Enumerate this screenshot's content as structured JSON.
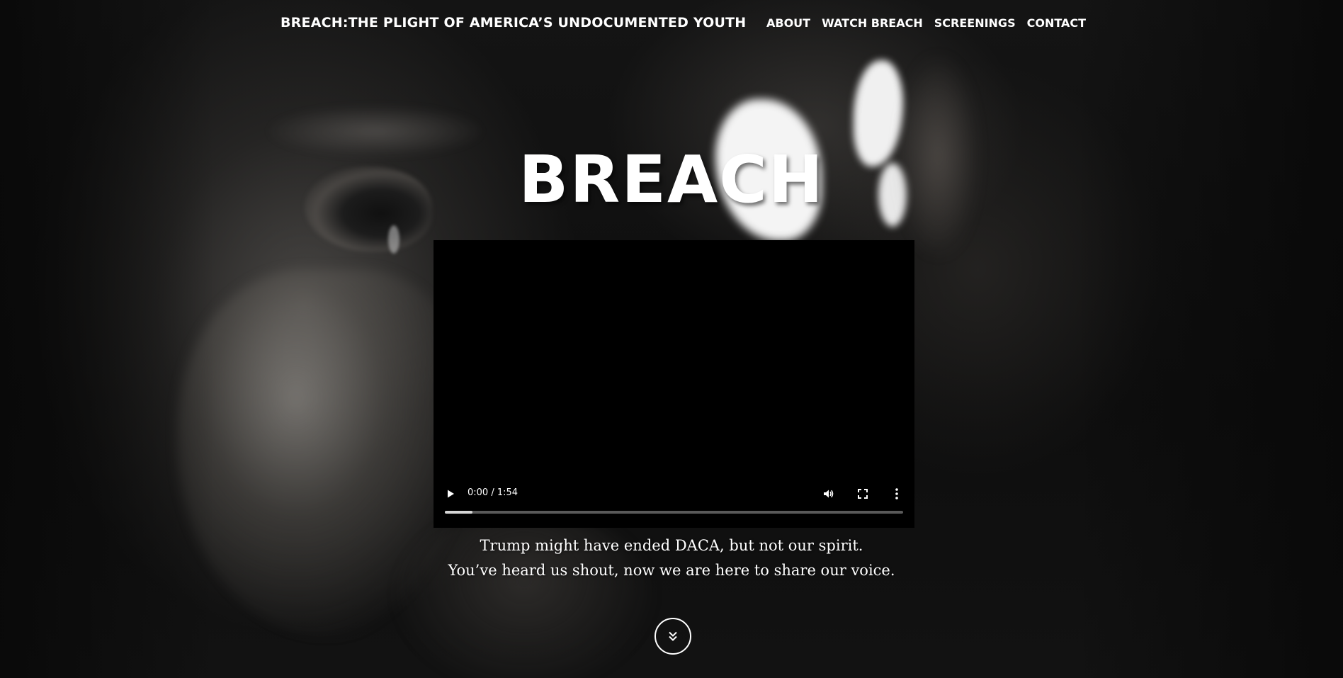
{
  "header": {
    "site_title": "BREACH:THE PLIGHT OF AMERICA’S UNDOCUMENTED YOUTH",
    "nav": [
      {
        "label": "ABOUT"
      },
      {
        "label": "WATCH BREACH"
      },
      {
        "label": "SCREENINGS"
      },
      {
        "label": "CONTACT"
      }
    ]
  },
  "hero": {
    "title": "BREACH"
  },
  "video": {
    "time": "0:00 / 1:54",
    "buffered_fraction": 0.06,
    "icons": {
      "play": "play-icon",
      "volume": "volume-icon",
      "fullscreen": "fullscreen-icon",
      "more": "more-vertical-icon"
    }
  },
  "tagline": {
    "line1": "Trump might have ended DACA, but not our spirit.",
    "line2": "You’ve heard us shout, now we are here to share our voice."
  },
  "scroll": {
    "icon": "double-chevron-down-icon"
  },
  "colors": {
    "text": "#ffffff",
    "background": "#0d0d0d",
    "video_bg": "#000000"
  }
}
